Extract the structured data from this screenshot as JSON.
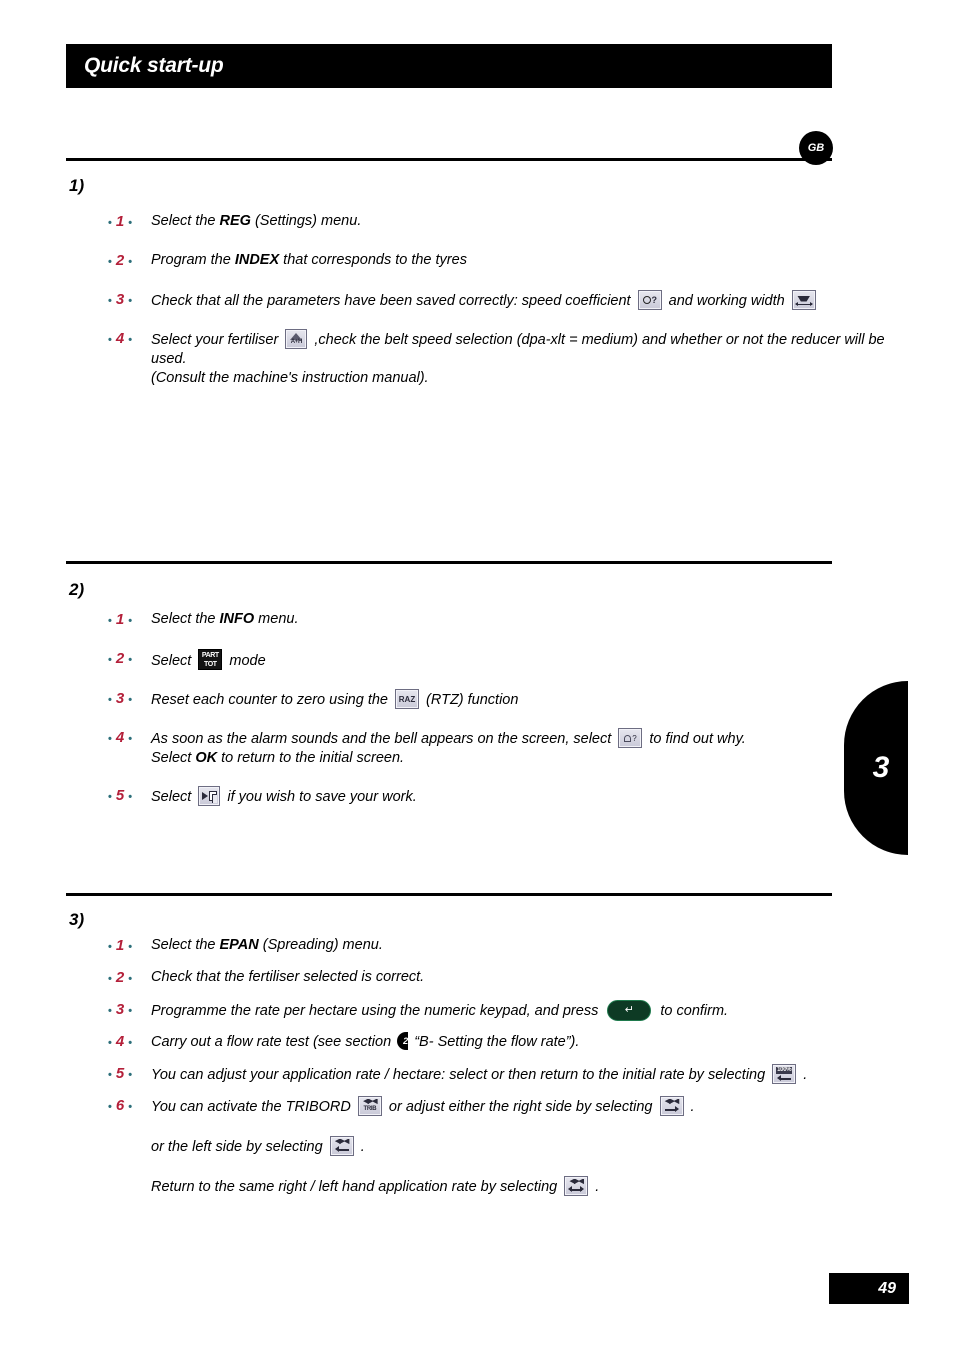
{
  "header": {
    "title": "Quick start-up",
    "language_badge": "GB"
  },
  "thumb_tab": {
    "number": "3"
  },
  "footer": {
    "page_number": "49"
  },
  "sections": [
    {
      "label": "1)",
      "steps": [
        {
          "number": "1",
          "lines": [
            [
              {
                "t": "text",
                "v": "Select the "
              },
              {
                "t": "bold",
                "v": "REG"
              },
              {
                "t": "text",
                "v": " (Settings) menu."
              }
            ]
          ]
        },
        {
          "number": "2",
          "lines": [
            [
              {
                "t": "text",
                "v": "Program the "
              },
              {
                "t": "bold",
                "v": "INDEX"
              },
              {
                "t": "text",
                "v": " that corresponds to the tyres"
              }
            ]
          ]
        },
        {
          "number": "3",
          "lines": [
            [
              {
                "t": "text",
                "v": "Check that all the parameters have been saved correctly: speed coefficient "
              },
              {
                "t": "icon",
                "v": "speed-coefficient-icon"
              },
              {
                "t": "text",
                "v": " and working width "
              },
              {
                "t": "icon",
                "v": "working-width-icon"
              }
            ]
          ]
        },
        {
          "number": "4",
          "lines": [
            [
              {
                "t": "text",
                "v": "Select your fertiliser "
              },
              {
                "t": "icon",
                "v": "fertiliser-icon"
              },
              {
                "t": "text",
                "v": " ,check the belt speed selection (dpa-xlt = medium) and whether or not the reducer will be used."
              }
            ],
            [
              {
                "t": "text",
                "v": "(Consult the machine's instruction manual)."
              }
            ]
          ]
        }
      ]
    },
    {
      "label": "2)",
      "steps": [
        {
          "number": "1",
          "lines": [
            [
              {
                "t": "text",
                "v": "Select the "
              },
              {
                "t": "bold",
                "v": "INFO"
              },
              {
                "t": "text",
                "v": " menu."
              }
            ]
          ]
        },
        {
          "number": "2",
          "lines": [
            [
              {
                "t": "text",
                "v": "Select "
              },
              {
                "t": "icon",
                "v": "part-tot-icon"
              },
              {
                "t": "text",
                "v": " mode"
              }
            ]
          ]
        },
        {
          "number": "3",
          "lines": [
            [
              {
                "t": "text",
                "v": "Reset each counter to zero using the "
              },
              {
                "t": "icon",
                "v": "raz-icon"
              },
              {
                "t": "text",
                "v": " (RTZ) function"
              }
            ]
          ]
        },
        {
          "number": "4",
          "lines": [
            [
              {
                "t": "text",
                "v": "As soon as the alarm sounds and the bell appears on the screen, select "
              },
              {
                "t": "icon",
                "v": "alarm-query-icon"
              },
              {
                "t": "text",
                "v": " to find out why."
              }
            ],
            [
              {
                "t": "text",
                "v": "Select "
              },
              {
                "t": "bold",
                "v": "OK"
              },
              {
                "t": "text",
                "v": " to return to the initial screen."
              }
            ]
          ]
        },
        {
          "number": "5",
          "lines": [
            [
              {
                "t": "text",
                "v": "Select "
              },
              {
                "t": "icon",
                "v": "save-work-icon"
              },
              {
                "t": "text",
                "v": " if you wish to save your work."
              }
            ]
          ]
        }
      ]
    },
    {
      "label": "3)",
      "steps": [
        {
          "number": "1",
          "lines": [
            [
              {
                "t": "text",
                "v": "Select the "
              },
              {
                "t": "bold",
                "v": "EPAN"
              },
              {
                "t": "text",
                "v": " (Spreading) menu."
              }
            ]
          ]
        },
        {
          "number": "2",
          "lines": [
            [
              {
                "t": "text",
                "v": "Check that the fertiliser selected is correct."
              }
            ]
          ]
        },
        {
          "number": "3",
          "lines": [
            [
              {
                "t": "text",
                "v": "Programme the rate per hectare using the numeric keypad, and press "
              },
              {
                "t": "icon",
                "v": "enter-confirm-button"
              },
              {
                "t": "text",
                "v": " to confirm."
              }
            ]
          ]
        },
        {
          "number": "4",
          "lines": [
            [
              {
                "t": "text",
                "v": "Carry out a flow rate test (see section "
              },
              {
                "t": "icon",
                "v": "section-2-tab-marker"
              },
              {
                "t": "text",
                "v": " “B- Setting the flow rate”)."
              }
            ]
          ]
        },
        {
          "number": "5",
          "lines": [
            [
              {
                "t": "text",
                "v": "You can adjust your application rate / hectare: select        or        then return to the initial rate by selecting "
              },
              {
                "t": "icon",
                "v": "return-100-percent-icon"
              },
              {
                "t": "text",
                "v": " ."
              }
            ]
          ]
        },
        {
          "number": "6",
          "lines": [
            [
              {
                "t": "text",
                "v": "You can activate the TRIBORD "
              },
              {
                "t": "icon",
                "v": "tribord-icon"
              },
              {
                "t": "text",
                "v": " or adjust either the right side by selecting "
              },
              {
                "t": "icon",
                "v": "adjust-right-side-icon"
              },
              {
                "t": "text",
                "v": " ."
              }
            ],
            [
              {
                "t": "gap",
                "v": ""
              }
            ],
            [
              {
                "t": "text",
                "v": "or the left side by selecting "
              },
              {
                "t": "icon",
                "v": "adjust-left-side-icon"
              },
              {
                "t": "text",
                "v": " ."
              }
            ],
            [
              {
                "t": "gap",
                "v": ""
              }
            ],
            [
              {
                "t": "text",
                "v": "Return to the same right / left hand application rate by selecting "
              },
              {
                "t": "icon",
                "v": "same-both-sides-icon"
              },
              {
                "t": "text",
                "v": " ."
              }
            ]
          ]
        }
      ]
    }
  ],
  "icon_glyphs": {
    "part-tot-icon": {
      "top": "PART",
      "bottom": "TOT"
    },
    "raz-icon": {
      "label": "RAZ"
    },
    "fertiliser-icon": {
      "label": "A+H"
    },
    "tribord-icon": {
      "label": "TRIB"
    },
    "return-100-percent-icon": {
      "label": "100%"
    },
    "enter-confirm-button": {
      "glyph": "↵"
    }
  },
  "colors": {
    "accent_red": "#b4203a",
    "accent_teal": "#2c6f7a",
    "black": "#000000",
    "confirm_green": "#1f7a4d"
  }
}
